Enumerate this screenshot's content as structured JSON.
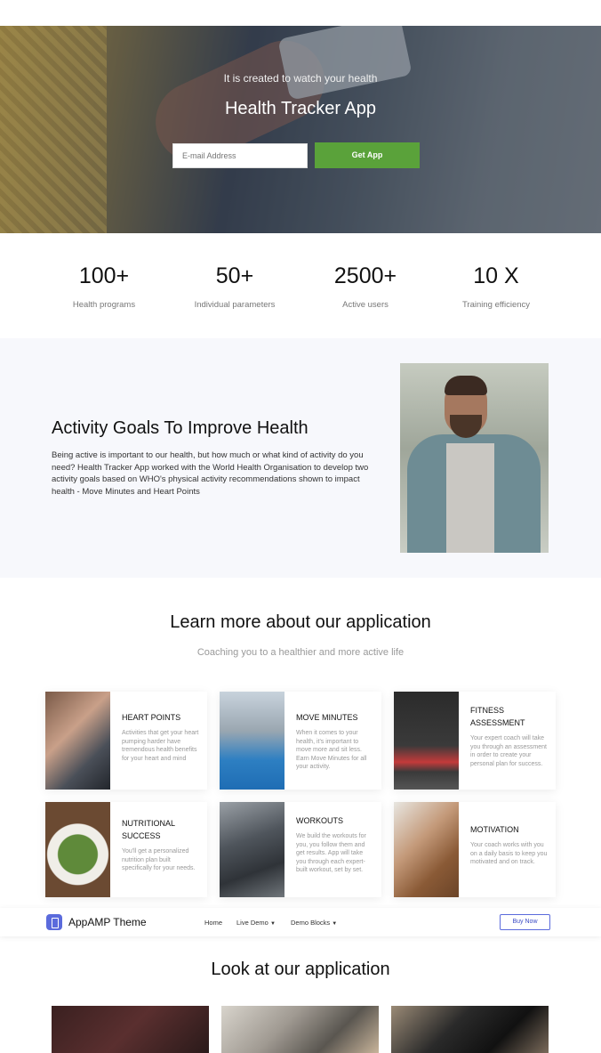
{
  "hero": {
    "subtitle": "It is created to watch your health",
    "title": "Health Tracker App",
    "email_placeholder": "E-mail Address",
    "button_label": "Get App",
    "button_color": "#5aa23a"
  },
  "stats": [
    {
      "value": "100+",
      "label": "Health programs"
    },
    {
      "value": "50+",
      "label": "Individual parameters"
    },
    {
      "value": "2500+",
      "label": "Active users"
    },
    {
      "value": "10 X",
      "label": "Training efficiency"
    }
  ],
  "activity": {
    "title": "Activity Goals To Improve Health",
    "text": "Being active is important to our health, but how much or what kind of activity do you need? Health Tracker App worked with the World Health Organisation to develop two activity goals based on WHO's physical activity recommendations shown to impact health - Move Minutes and Heart Points"
  },
  "learn": {
    "title": "Learn more about our application",
    "subtitle": "Coaching you to a healthier and more active life",
    "cards": [
      {
        "name": "HEART POINTS",
        "desc": "Activities that get your heart pumping harder have tremendous health benefits for your heart and mind"
      },
      {
        "name": "MOVE MINUTES",
        "desc": "When it comes to your health, it's important to move more and sit less. Earn Move Minutes for all your activity."
      },
      {
        "name": "FITNESS ASSESSMENT",
        "desc": "Your expert coach will take you through an assessment in order to create your personal plan for success."
      },
      {
        "name": "NUTRITIONAL SUCCESS",
        "desc": "You'll get a personalized nutrition plan built specifically for your needs."
      },
      {
        "name": "WORKOUTS",
        "desc": "We build the workouts for you, you follow them and get results. App will take you through each expert-built workout, set by set."
      },
      {
        "name": "MOTIVATION",
        "desc": "Your coach works with you on a daily basis to keep you motivated and on track."
      }
    ]
  },
  "navbar": {
    "brand": "AppAMP Theme",
    "items": [
      "Home",
      "Live Demo",
      "Demo Blocks"
    ],
    "buy_label": "Buy Now",
    "accent": "#5b6bdc"
  },
  "look": {
    "title": "Look at our application"
  }
}
